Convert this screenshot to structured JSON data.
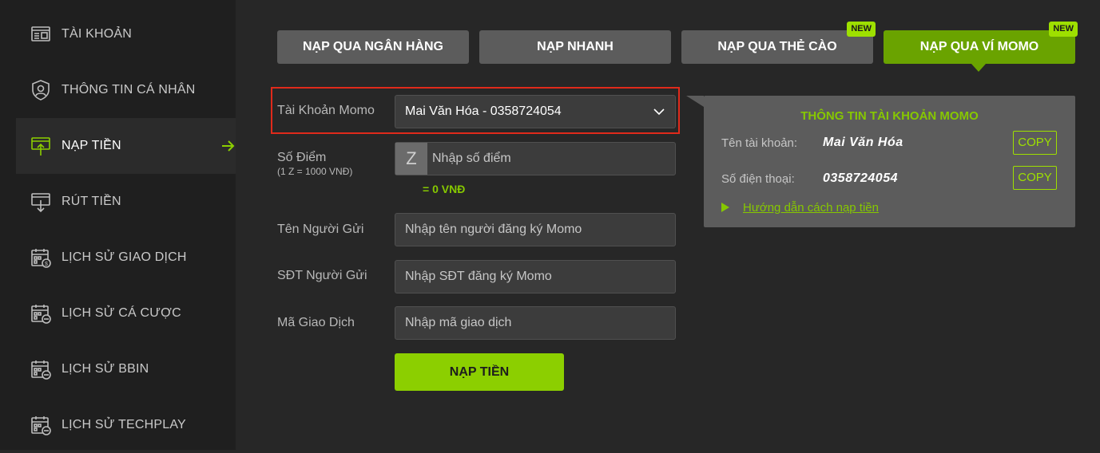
{
  "sidebar": {
    "items": [
      {
        "label": "TÀI KHOẢN",
        "icon": "account-icon"
      },
      {
        "label": "THÔNG TIN CÁ NHÂN",
        "icon": "profile-shield-icon"
      },
      {
        "label": "NẠP TIỀN",
        "icon": "deposit-icon",
        "active": true
      },
      {
        "label": "RÚT TIỀN",
        "icon": "withdraw-icon"
      },
      {
        "label": "LỊCH SỬ GIAO DỊCH",
        "icon": "calendar-icon"
      },
      {
        "label": "LỊCH SỬ CÁ CƯỢC",
        "icon": "calendar-icon"
      },
      {
        "label": "LỊCH SỬ BBIN",
        "icon": "calendar-icon"
      },
      {
        "label": "LỊCH SỬ TECHPLAY",
        "icon": "calendar-icon"
      }
    ]
  },
  "tabs": [
    {
      "label": "NẠP QUA NGÂN HÀNG"
    },
    {
      "label": "NẠP NHANH"
    },
    {
      "label": "NẠP QUA THẺ CÀO",
      "badge": "NEW"
    },
    {
      "label": "NẠP QUA VÍ MOMO",
      "badge": "NEW",
      "active": true
    }
  ],
  "form": {
    "momo_account": {
      "label": "Tài Khoản Momo",
      "value": "Mai Văn Hóa - 0358724054"
    },
    "points": {
      "label": "Số Điểm",
      "sublabel": "(1 Z = 1000 VNĐ)",
      "prefix": "Z",
      "placeholder": "Nhập số điểm",
      "conversion": "= 0 VNĐ"
    },
    "sender_name": {
      "label": "Tên Người Gửi",
      "placeholder": "Nhập tên người đăng ký Momo"
    },
    "sender_phone": {
      "label": "SĐT Người Gửi",
      "placeholder": "Nhập SĐT đăng ký Momo"
    },
    "transaction_code": {
      "label": "Mã Giao Dịch",
      "placeholder": "Nhập mã giao dịch"
    },
    "submit_label": "NẠP TIỀN"
  },
  "info": {
    "title": "THÔNG TIN TÀI KHOẢN MOMO",
    "name_label": "Tên tài khoản:",
    "name_value": "Mai Văn Hóa",
    "phone_label": "Số điện thoại:",
    "phone_value": "0358724054",
    "copy_label": "COPY",
    "guide_link": "Hướng dẫn cách nạp tiền"
  },
  "colors": {
    "accent": "#8ccf00",
    "active_tab": "#6aa300",
    "highlight": "#e02a1b"
  }
}
